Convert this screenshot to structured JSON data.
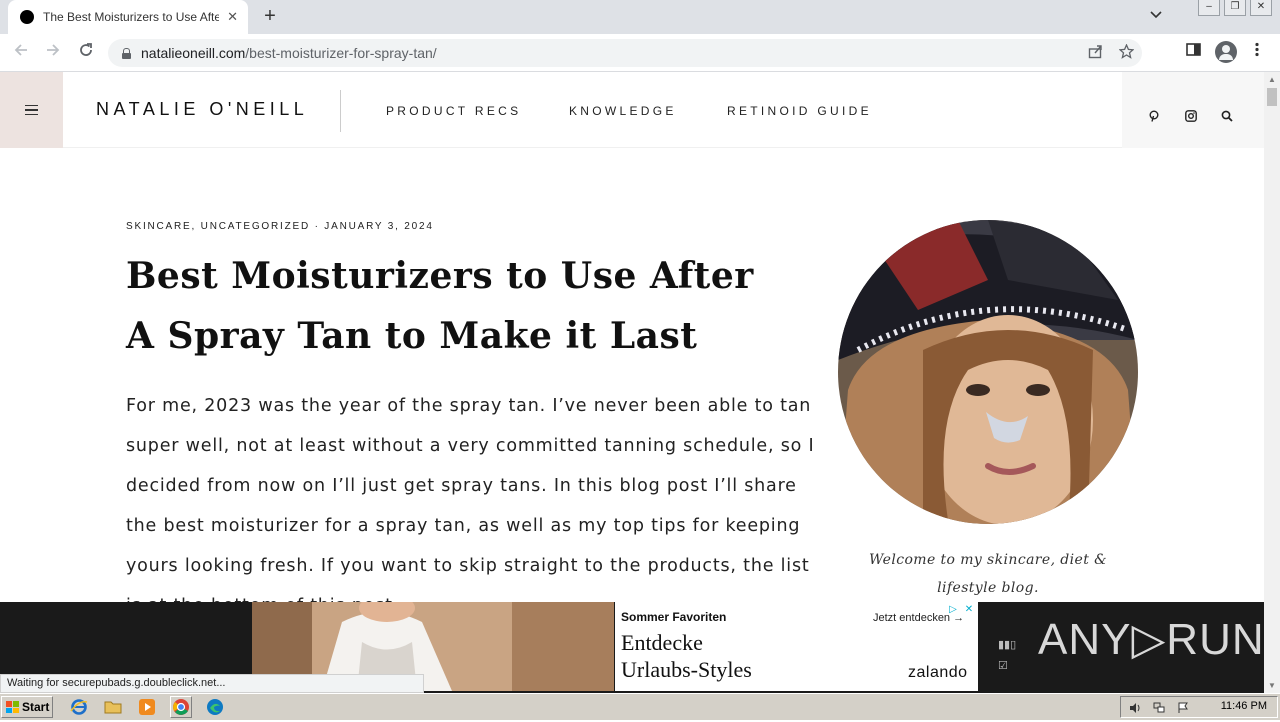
{
  "browser": {
    "tab_title": "The Best Moisturizers to Use After A",
    "close_glyph": "✕",
    "new_tab_glyph": "+",
    "tab_search_glyph": "⌄",
    "url_host": "natalieoneill.com",
    "url_path": "/best-moisturizer-for-spray-tan/",
    "status_text": "Waiting for securepubads.g.doubleclick.net..."
  },
  "site": {
    "logo": "NATALIE O'NEILL",
    "nav": [
      "PRODUCT RECS",
      "KNOWLEDGE",
      "RETINOID GUIDE"
    ]
  },
  "article": {
    "meta": "SKINCARE, UNCATEGORIZED · JANUARY 3, 2024",
    "title": "Best Moisturizers to Use After A Spray Tan to Make it Last",
    "body": "For me, 2023 was the year of the spray tan. I’ve never been able to tan super well, not at least without a very committed tanning schedule, so I decided from now on I’ll just get spray tans. In this blog post I’ll share the best moisturizer for a spray tan, as well as my top tips for keeping yours looking fresh. If you want to skip straight to the products, the list is at the bottom of this post."
  },
  "sidebar": {
    "welcome": "Welcome to my skincare, diet & lifestyle blog."
  },
  "ad": {
    "heading": "Sommer Favoriten",
    "cta": "Jetzt entdecken →",
    "headline_line1": "Entdecke",
    "headline_line2": "Urlaubs-Styles",
    "brand": "zalando",
    "badge_play": "▷",
    "badge_close": "✕"
  },
  "watermark": "ANY▷RUN",
  "taskbar": {
    "start_label": "Start",
    "clock": "11:46 PM"
  },
  "colors": {
    "hamburger_bg": "#ede3e0",
    "tab_strip": "#dee1e6",
    "ad_accent": "#00aecd",
    "taskbar": "#d4d0c8"
  }
}
